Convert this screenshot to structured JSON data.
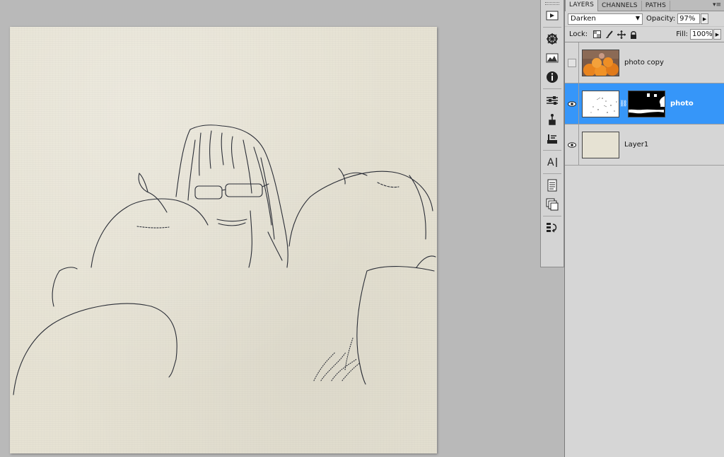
{
  "panel": {
    "tabs": [
      {
        "label": "LAYERS",
        "active": true
      },
      {
        "label": "CHANNELS",
        "active": false
      },
      {
        "label": "PATHS",
        "active": false
      }
    ],
    "blend_mode": "Darken",
    "opacity_label": "Opacity:",
    "opacity_value": "97%",
    "lock_label": "Lock:",
    "fill_label": "Fill:",
    "fill_value": "100%"
  },
  "layers": [
    {
      "name": "photo copy",
      "visible": false,
      "selected": false,
      "has_mask": false
    },
    {
      "name": "photo",
      "visible": true,
      "selected": true,
      "has_mask": true
    },
    {
      "name": "Layer1",
      "visible": true,
      "selected": false,
      "has_mask": false
    }
  ],
  "colors": {
    "selection": "#3696f9",
    "paper": "#e6e2d3",
    "workspace": "#b9b9b9"
  },
  "dock_icons": [
    "actions-icon",
    "navigator-icon",
    "histogram-icon",
    "info-icon",
    "adjustments-icon",
    "clone-source-icon",
    "tool-presets-icon",
    "character-icon",
    "notes-icon",
    "layer-comps-icon",
    "history-icon"
  ]
}
